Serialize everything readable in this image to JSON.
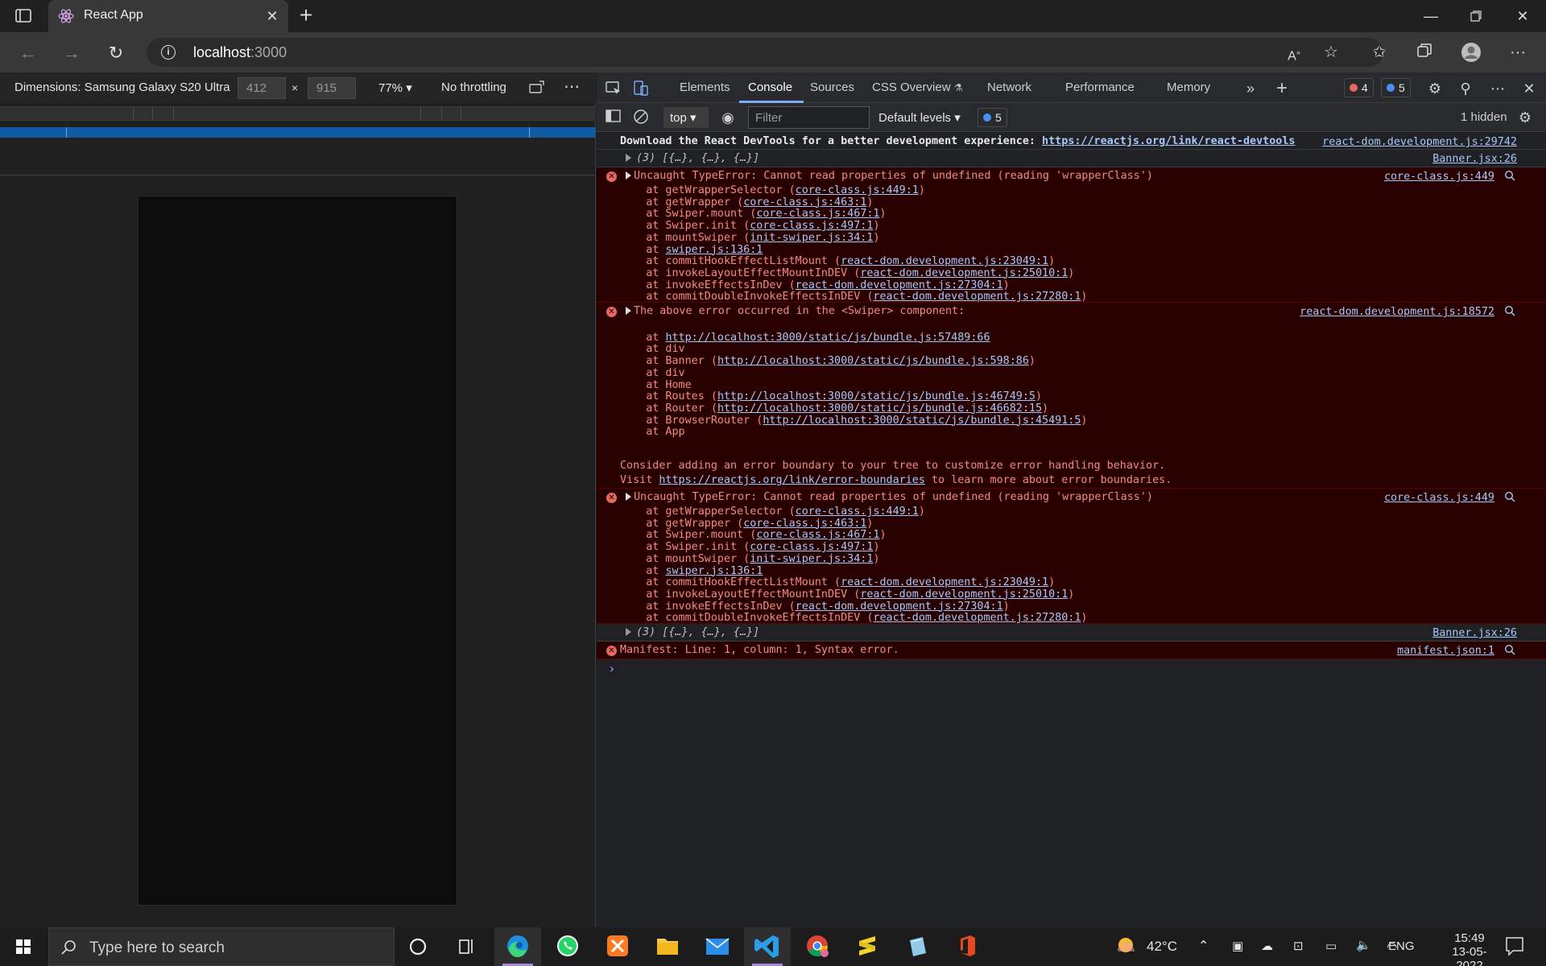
{
  "browser": {
    "tab_title": "React App",
    "url_host": "localhost",
    "url_port": ":3000"
  },
  "device_toolbar": {
    "dimensions_label": "Dimensions: Samsung Galaxy S20 Ultra",
    "width": "412",
    "height": "915",
    "times": "×",
    "zoom": "77%",
    "throttling": "No throttling"
  },
  "devtools": {
    "tabs": [
      "Elements",
      "Console",
      "Sources",
      "CSS Overview",
      "Network",
      "Performance",
      "Memory"
    ],
    "active_tab": "Console",
    "error_count": "4",
    "issue_count": "5",
    "context": "top",
    "filter_placeholder": "Filter",
    "levels": "Default levels",
    "issues_badge": "5",
    "hidden": "1 hidden"
  },
  "console": {
    "msg1": {
      "text": "Download the React DevTools for a better development experience: ",
      "link": "https://reactjs.org/link/react-devtools",
      "src": "react-dom.development.js:29742"
    },
    "msg2": {
      "text": "(3) [{…}, {…}, {…}]",
      "src": "Banner.jsx:26"
    },
    "msg3": {
      "text": "Uncaught TypeError: Cannot read properties of undefined (reading 'wrapperClass')",
      "src": "core-class.js:449",
      "stack": [
        {
          "fn": "    at getWrapperSelector (",
          "loc": "core-class.js:449:1",
          "end": ")"
        },
        {
          "fn": "    at getWrapper (",
          "loc": "core-class.js:463:1",
          "end": ")"
        },
        {
          "fn": "    at Swiper.mount (",
          "loc": "core-class.js:467:1",
          "end": ")"
        },
        {
          "fn": "    at Swiper.init (",
          "loc": "core-class.js:497:1",
          "end": ")"
        },
        {
          "fn": "    at mountSwiper (",
          "loc": "init-swiper.js:34:1",
          "end": ")"
        },
        {
          "fn": "    at ",
          "loc": "swiper.js:136:1",
          "end": ""
        },
        {
          "fn": "    at commitHookEffectListMount (",
          "loc": "react-dom.development.js:23049:1",
          "end": ")"
        },
        {
          "fn": "    at invokeLayoutEffectMountInDEV (",
          "loc": "react-dom.development.js:25010:1",
          "end": ")"
        },
        {
          "fn": "    at invokeEffectsInDev (",
          "loc": "react-dom.development.js:27304:1",
          "end": ")"
        },
        {
          "fn": "    at commitDoubleInvokeEffectsInDEV (",
          "loc": "react-dom.development.js:27280:1",
          "end": ")"
        }
      ]
    },
    "msg4": {
      "text": "The above error occurred in the <Swiper> component:",
      "src": "react-dom.development.js:18572",
      "stack": [
        {
          "fn": "",
          "loc": "",
          "end": ""
        },
        {
          "fn": "    at ",
          "loc": "http://localhost:3000/static/js/bundle.js:57489:66",
          "end": ""
        },
        {
          "fn": "    at div",
          "loc": "",
          "end": ""
        },
        {
          "fn": "    at Banner (",
          "loc": "http://localhost:3000/static/js/bundle.js:598:86",
          "end": ")"
        },
        {
          "fn": "    at div",
          "loc": "",
          "end": ""
        },
        {
          "fn": "    at Home",
          "loc": "",
          "end": ""
        },
        {
          "fn": "    at Routes (",
          "loc": "http://localhost:3000/static/js/bundle.js:46749:5",
          "end": ")"
        },
        {
          "fn": "    at Router (",
          "loc": "http://localhost:3000/static/js/bundle.js:46682:15",
          "end": ")"
        },
        {
          "fn": "    at BrowserRouter (",
          "loc": "http://localhost:3000/static/js/bundle.js:45491:5",
          "end": ")"
        },
        {
          "fn": "    at App",
          "loc": "",
          "end": ""
        },
        {
          "fn": "",
          "loc": "",
          "end": ""
        }
      ],
      "footer1": "Consider adding an error boundary to your tree to customize error handling behavior.",
      "footer2_pre": "Visit ",
      "footer2_link": "https://reactjs.org/link/error-boundaries",
      "footer2_post": " to learn more about error boundaries."
    },
    "msg5": {
      "text": "Uncaught TypeError: Cannot read properties of undefined (reading 'wrapperClass')",
      "src": "core-class.js:449"
    },
    "msg6": {
      "text": "(3) [{…}, {…}, {…}]",
      "src": "Banner.jsx:26"
    },
    "msg7": {
      "text": "Manifest: Line: 1, column: 1, Syntax error.",
      "src": "manifest.json:1"
    }
  },
  "taskbar": {
    "search_placeholder": "Type here to search",
    "temperature": "42°C",
    "language": "ENG",
    "time": "15:49",
    "date": "13-05-2022"
  },
  "colors": {
    "error_bg": "#290000",
    "error_text": "#f28b82",
    "link": "#a8c7fa",
    "accent": "#7cacf8"
  }
}
